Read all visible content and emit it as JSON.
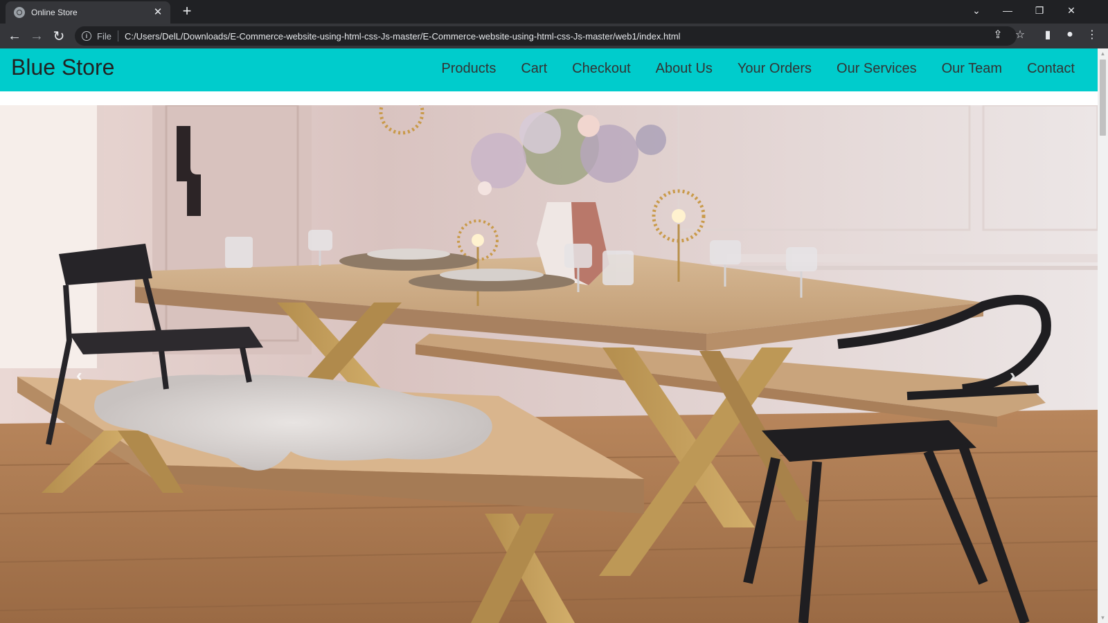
{
  "browser": {
    "tab": {
      "title": "Online Store",
      "close_glyph": "✕",
      "favicon": "globe-icon"
    },
    "new_tab_glyph": "+",
    "window_controls": {
      "tab_search": "⌄",
      "minimize": "—",
      "restore": "❐",
      "close": "✕"
    },
    "nav": {
      "back": "←",
      "forward": "→",
      "reload": "↻"
    },
    "address": {
      "info_glyph": "i",
      "scheme_label": "File",
      "url": "C:/Users/DelL/Downloads/E-Commerce-website-using-html-css-Js-master/E-Commerce-website-using-html-css-Js-master/web1/index.html"
    },
    "toolbar_icons": {
      "share": "⇪",
      "bookmark": "☆",
      "side_panel": "▮",
      "profile": "●",
      "menu": "⋮"
    }
  },
  "site": {
    "brand": "Blue Store",
    "menu": [
      {
        "label": "Products"
      },
      {
        "label": "Cart"
      },
      {
        "label": "Checkout"
      },
      {
        "label": "About Us"
      },
      {
        "label": "Your Orders"
      },
      {
        "label": "Our Services"
      },
      {
        "label": "Our Team"
      },
      {
        "label": "Contact"
      }
    ],
    "carousel": {
      "prev_glyph": "‹",
      "next_glyph": "›"
    },
    "colors": {
      "nav_background": "#00cccc",
      "brand_text": "#222222",
      "menu_text": "#333333"
    }
  },
  "scrollbar": {
    "up": "▲",
    "down": "▼"
  }
}
